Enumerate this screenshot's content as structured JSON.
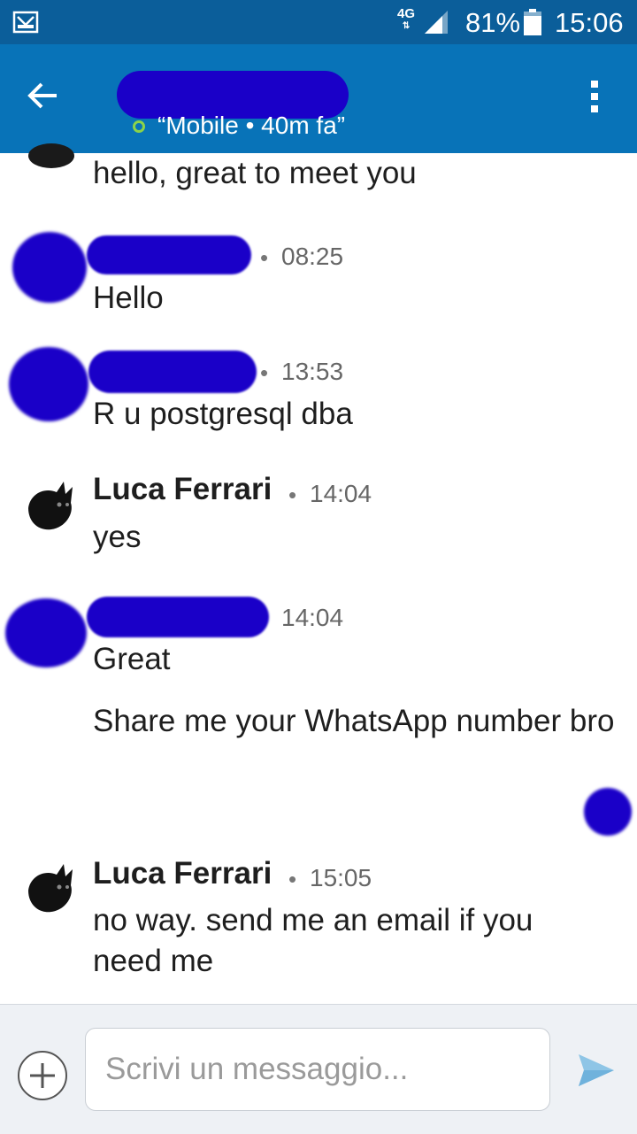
{
  "status_bar": {
    "network": "4G",
    "battery_percent": "81%",
    "time": "15:06"
  },
  "header": {
    "status_text": "“Mobile • 40m fa”",
    "presence_color": "#8bd34a"
  },
  "messages": {
    "m1": {
      "text": "hello, great to meet you"
    },
    "m2": {
      "dot": "•",
      "time": "08:25",
      "text": "Hello"
    },
    "m3": {
      "dot": "•",
      "time": "13:53",
      "text": "R u postgresql dba"
    },
    "m4": {
      "sender": "Luca Ferrari",
      "dot": "•",
      "time": "14:04",
      "text": "yes"
    },
    "m5": {
      "time": "14:04",
      "text": "Great",
      "text2": "Share me your WhatsApp number bro"
    },
    "m6": {
      "sender": "Luca Ferrari",
      "dot": "•",
      "time": "15:05",
      "text": "no way. send me an email if you need me"
    }
  },
  "composer": {
    "placeholder": "Scrivi un messaggio..."
  },
  "colors": {
    "status_bar": "#0b5e9a",
    "app_bar": "#0873b8",
    "redaction": "#1a00c8",
    "send_icon": "#8ec5e6"
  },
  "icons": {
    "mail": "mail-icon",
    "back": "arrow-left-icon",
    "menu": "more-vert-icon",
    "add": "plus-icon",
    "send": "send-icon",
    "avatar": "cat-avatar-icon"
  }
}
